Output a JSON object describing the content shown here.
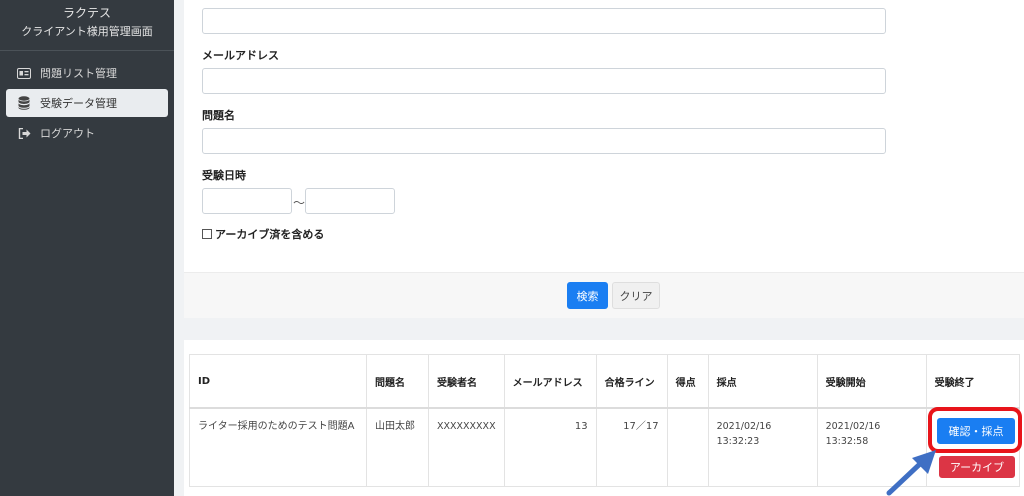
{
  "sidebar": {
    "brand_line1": "ラクテス",
    "brand_line2": "クライアント様用管理画面",
    "items": [
      {
        "label": "問題リスト管理",
        "icon": "id-card-icon"
      },
      {
        "label": "受験データ管理",
        "icon": "database-icon",
        "active": true
      },
      {
        "label": "ログアウト",
        "icon": "sign-out-icon"
      }
    ]
  },
  "search": {
    "fields": [
      {
        "label": "",
        "value": ""
      },
      {
        "label": "メールアドレス",
        "value": ""
      },
      {
        "label": "問題名",
        "value": ""
      }
    ],
    "date_label": "受験日時",
    "date_from": "",
    "date_to": "",
    "tilde": "〜",
    "archive_label": "アーカイブ済を含める",
    "search_button": "検索",
    "clear_button": "クリア"
  },
  "results": {
    "headers": [
      "ID",
      "問題名",
      "受験者名",
      "メールアドレス",
      "合格ライン",
      "得点",
      "採点",
      "受験開始",
      "受験終了"
    ],
    "rows": [
      {
        "id": "ライター採用のためのテスト問題A",
        "question": "山田太郎",
        "examinee": "XXXXXXXXX",
        "email": "13",
        "pass_line": "17／17",
        "score": "",
        "graded": "2021/02/16 13:32:23",
        "started": "2021/02/16 13:32:58",
        "confirm_button": "確認・採点",
        "archive_button": "アーカイブ"
      }
    ]
  },
  "colors": {
    "sidebar_bg": "#343a40",
    "primary": "#1a7ef2",
    "danger": "#dc3545",
    "highlight": "#e8141a",
    "arrow": "#3f6fc4"
  }
}
